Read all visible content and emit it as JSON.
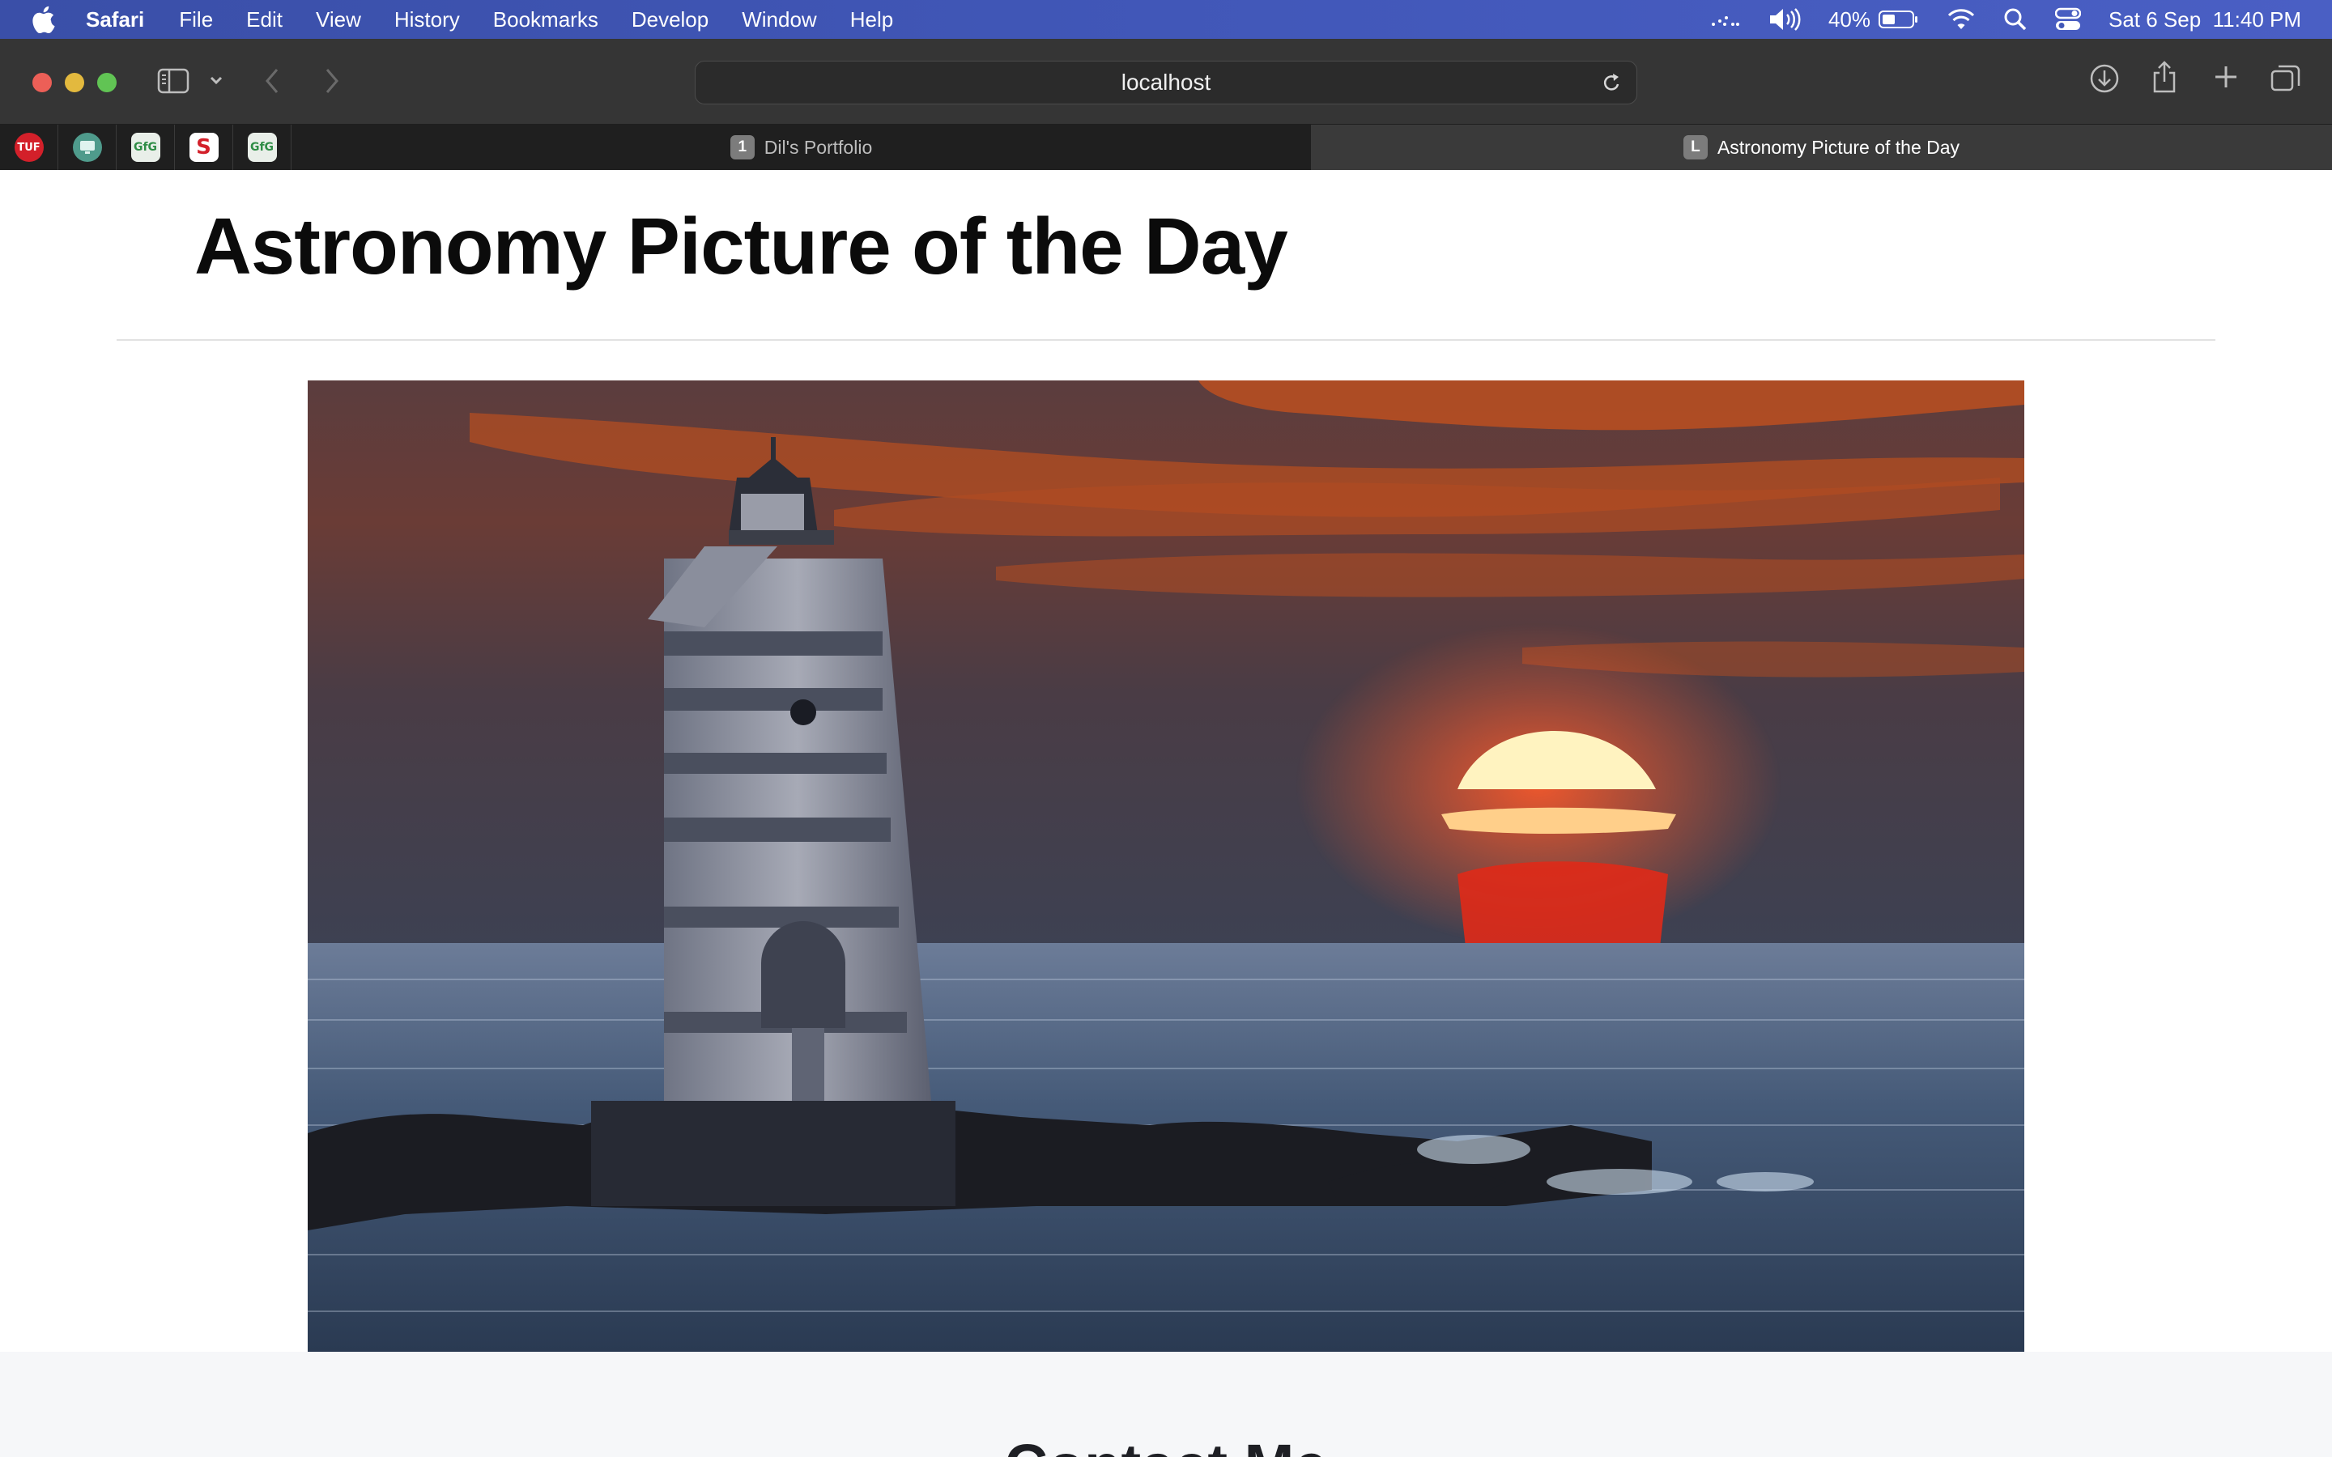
{
  "menubar": {
    "app": "Safari",
    "items": [
      "File",
      "Edit",
      "View",
      "History",
      "Bookmarks",
      "Develop",
      "Window",
      "Help"
    ],
    "battery_percent": "40%",
    "datetime": "Sat 6 Sep  11:40 PM"
  },
  "browser": {
    "address": "localhost",
    "pinned_tabs": [
      {
        "icon": "tuf-icon",
        "label": "TUF"
      },
      {
        "icon": "monitor-icon",
        "label": ""
      },
      {
        "icon": "geeksforgeeks-icon",
        "label": "GfG"
      },
      {
        "icon": "s-logo-icon",
        "label": "S"
      },
      {
        "icon": "geeksforgeeks-icon",
        "label": "GfG"
      }
    ],
    "tabs": [
      {
        "badge": "1",
        "title": "Dil's Portfolio",
        "active": false
      },
      {
        "badge": "L",
        "title": "Astronomy Picture of the Day",
        "active": true
      }
    ]
  },
  "page": {
    "title": "Astronomy Picture of the Day",
    "image_alt": "lighthouse-at-sunset-photo",
    "contact_heading": "Contact Me"
  },
  "colors": {
    "menubar": "#4157b8",
    "toolbar": "#353535",
    "tabbar": "#1f1f1f",
    "sun": "#fff3c0",
    "sky_orange": "#c9521c"
  }
}
